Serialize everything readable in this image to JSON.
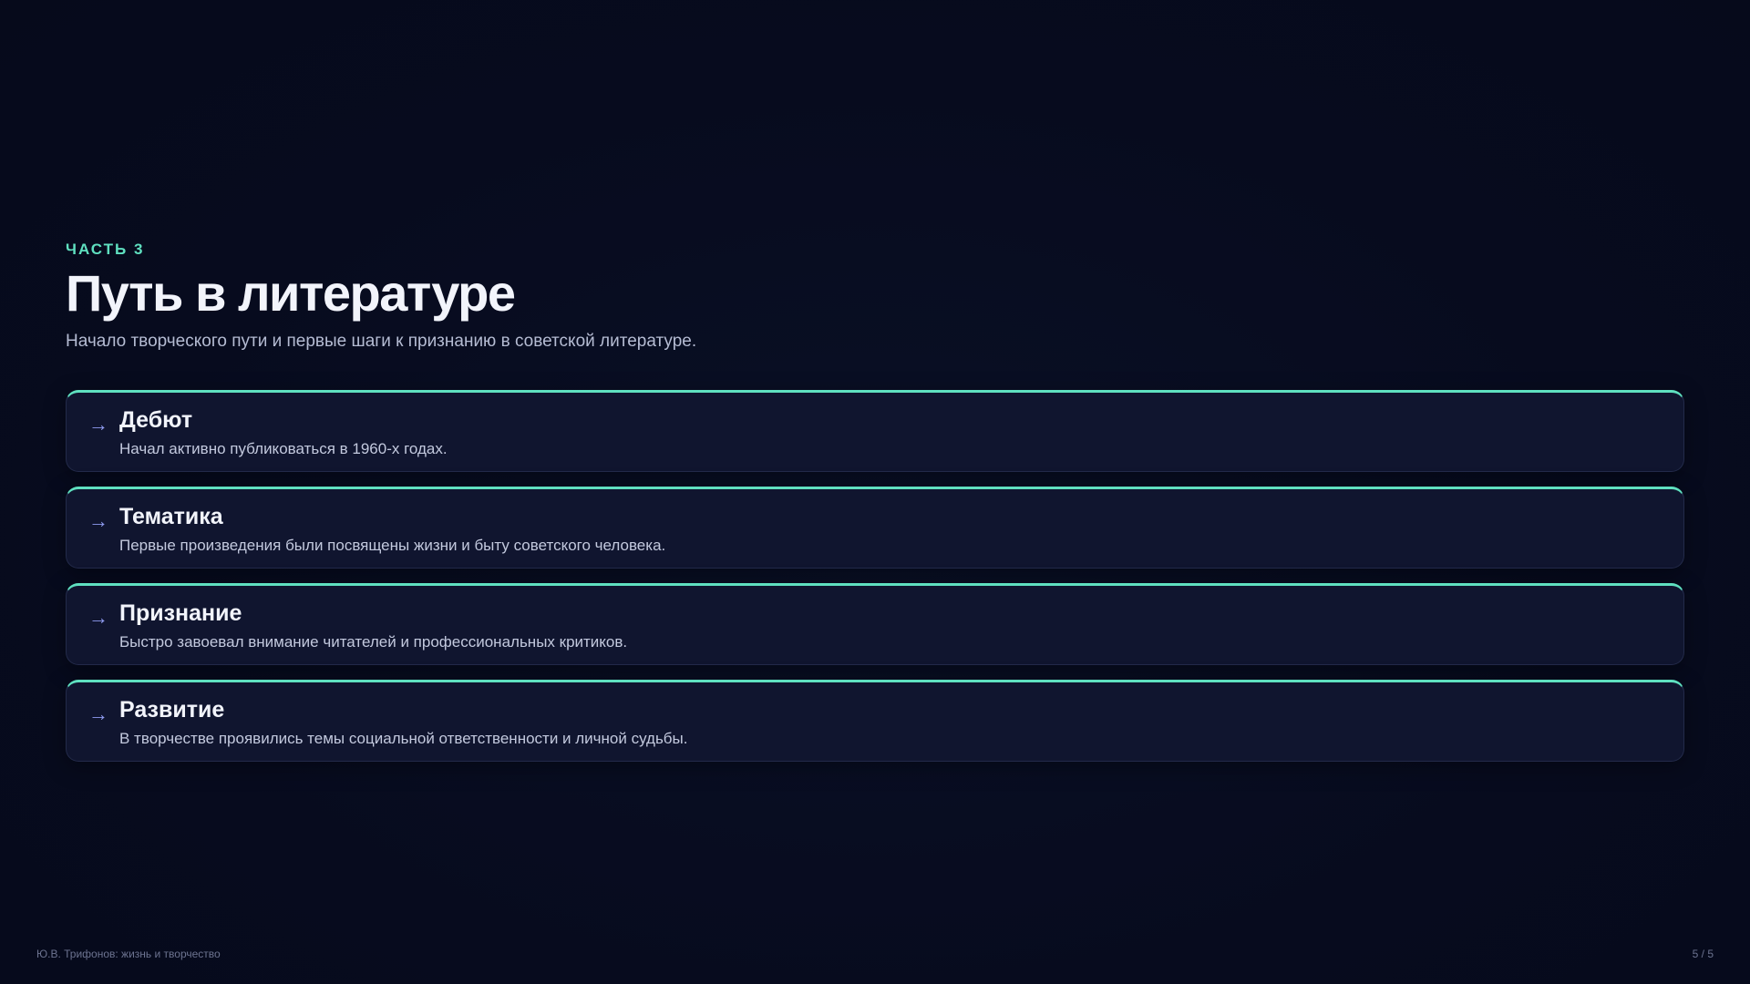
{
  "section_label": "ЧАСТЬ 3",
  "title": "Путь в литературе",
  "subtitle": "Начало творческого пути и первые шаги к признанию в советской литературе.",
  "arrow_glyph": "→",
  "cards": [
    {
      "title": "Дебют",
      "description": "Начал активно публиковаться в 1960-х годах."
    },
    {
      "title": "Тематика",
      "description": "Первые произведения были посвящены жизни и быту советского человека."
    },
    {
      "title": "Признание",
      "description": "Быстро завоевал внимание читателей и профессиональных критиков."
    },
    {
      "title": "Развитие",
      "description": "В творчестве проявились темы социальной ответственности и личной судьбы."
    }
  ],
  "footer": {
    "left": "Ю.В. Трифонов: жизнь и творчество",
    "page": "5 / 5"
  },
  "colors": {
    "background": "#070b1e",
    "accent": "#5fe0c0",
    "card_background": "#10152f",
    "arrow": "#8f9bf0"
  }
}
